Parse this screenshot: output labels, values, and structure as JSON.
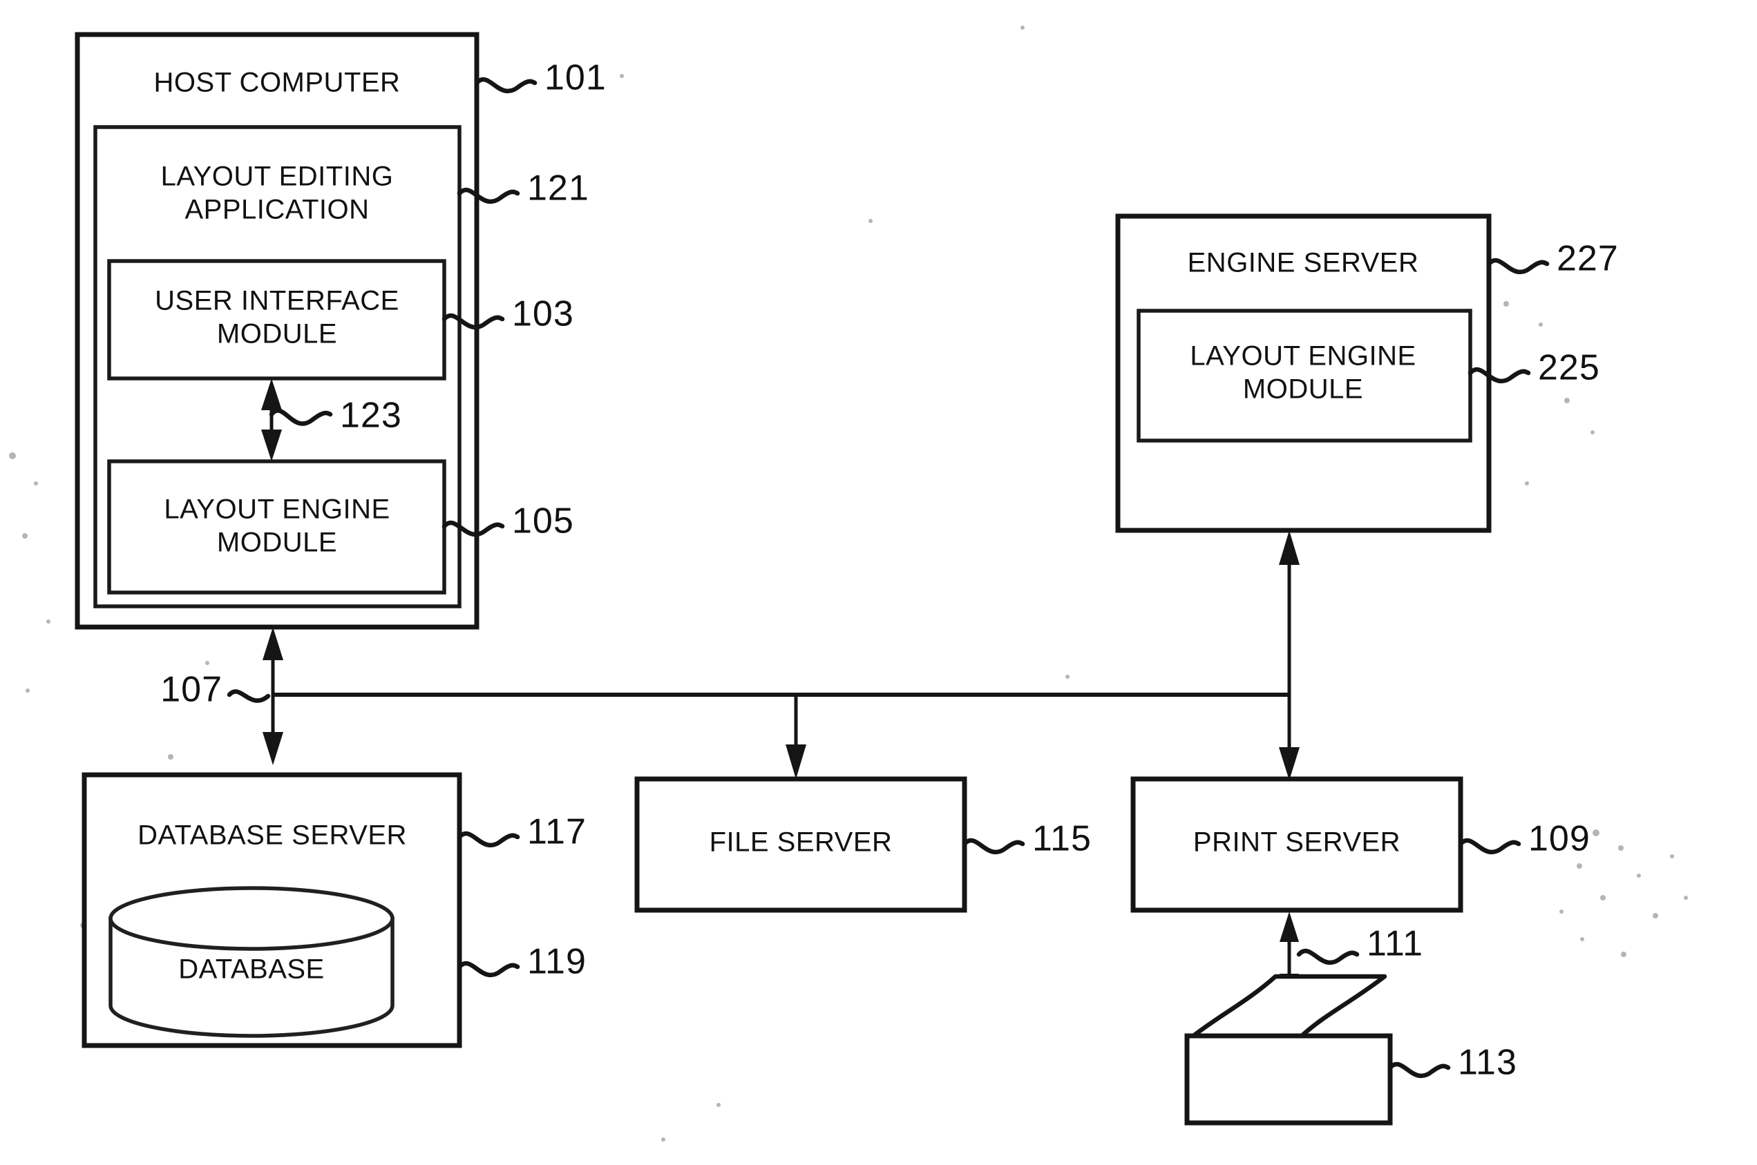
{
  "figure": {
    "kind": "patent-system-block-diagram",
    "background_color": "#ffffff",
    "ink_color": "#151515"
  },
  "blocks": {
    "host_computer": {
      "label": "HOST COMPUTER",
      "ref": "101"
    },
    "layout_editing_application": {
      "label_line1": "LAYOUT EDITING",
      "label_line2": "APPLICATION",
      "ref": "121"
    },
    "user_interface_module": {
      "label_line1": "USER INTERFACE",
      "label_line2": "MODULE",
      "ref": "103"
    },
    "layout_engine_module_host": {
      "label_line1": "LAYOUT ENGINE",
      "label_line2": "MODULE",
      "ref": "105"
    },
    "engine_server": {
      "label": "ENGINE SERVER",
      "ref": "227"
    },
    "layout_engine_module_server": {
      "label_line1": "LAYOUT ENGINE",
      "label_line2": "MODULE",
      "ref": "225"
    },
    "database_server": {
      "label": "DATABASE SERVER",
      "ref": "117"
    },
    "database": {
      "label": "DATABASE",
      "ref": "119"
    },
    "file_server": {
      "label": "FILE SERVER",
      "ref": "115"
    },
    "print_server": {
      "label": "PRINT SERVER",
      "ref": "109"
    },
    "printer": {
      "label": "",
      "ref": "113"
    }
  },
  "connectors": {
    "ui_to_engine_module": {
      "ref": "123",
      "style": "double-arrow-vertical"
    },
    "network_bus": {
      "ref": "107",
      "style": "horizontal-bus"
    },
    "print_server_to_printer": {
      "ref": "111",
      "style": "double-arrow-vertical"
    },
    "host_to_bus": {
      "style": "double-arrow-vertical"
    },
    "bus_to_file_server": {
      "style": "single-arrow-down"
    },
    "engine_server_to_print_server": {
      "style": "double-arrow-vertical"
    }
  }
}
